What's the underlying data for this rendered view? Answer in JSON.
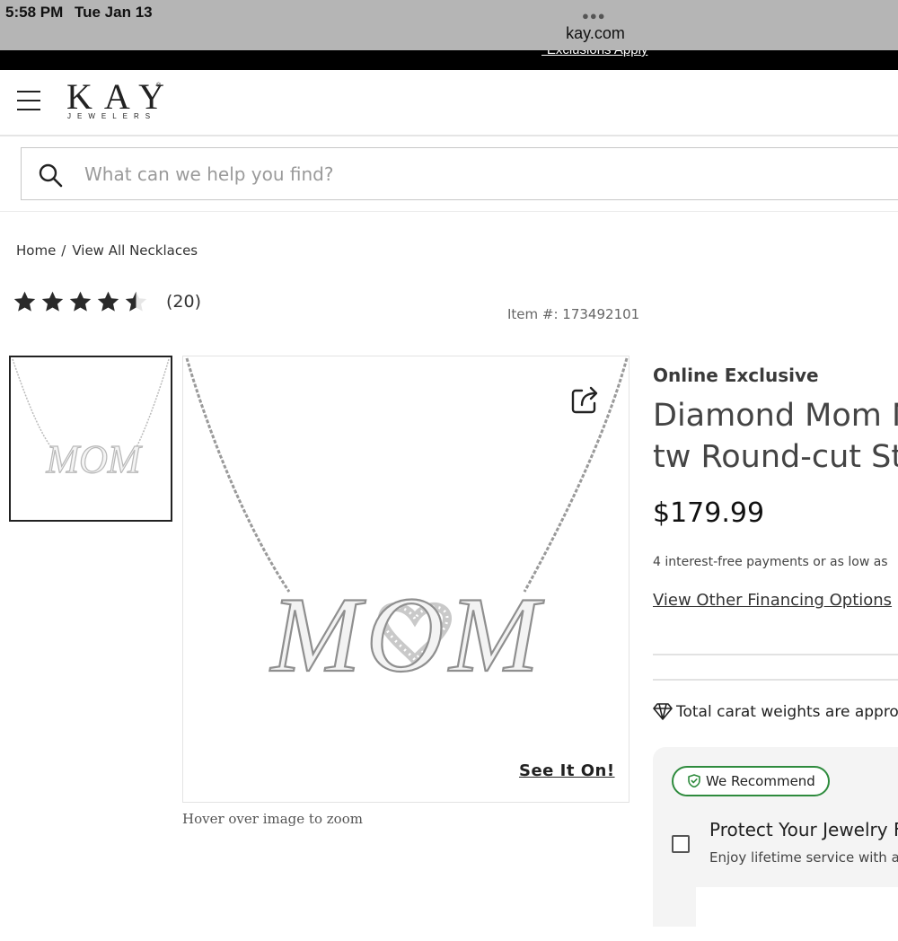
{
  "status_bar": {
    "time": "5:58 PM",
    "date": "Tue Jan 13",
    "url": "kay.com"
  },
  "promo": {
    "link": "*Exclusions Apply"
  },
  "header": {
    "logo_main": "KAY",
    "logo_sub": "JEWELERS"
  },
  "search": {
    "placeholder": "What can we help you find?"
  },
  "breadcrumb": {
    "home": "Home",
    "separator": "/",
    "current": "View All Necklaces"
  },
  "rating": {
    "stars": 4.5,
    "max": 5,
    "count": "(20)"
  },
  "item": {
    "number": "Item #: 173492101"
  },
  "gallery": {
    "main_image_text": "MOM",
    "see_it_on": "See It On!",
    "zoom_hint": "Hover over image to zoom"
  },
  "product": {
    "badge": "Online Exclusive",
    "title_line1": "Diamond Mom N",
    "title_line2": "tw Round-cut Sto",
    "price": "$179.99",
    "payments": "4 interest-free payments or as low as",
    "financing_link": "View Other Financing Options",
    "carat_note": "Total carat weights are appro"
  },
  "protection": {
    "badge": "We Recommend",
    "title": "Protect Your Jewelry F",
    "subtitle": "Enjoy lifetime service with a c"
  },
  "colors": {
    "recommend_green": "#2e8b3d",
    "promo_bar": "#000000",
    "status_bar": "#b5b5b5"
  }
}
